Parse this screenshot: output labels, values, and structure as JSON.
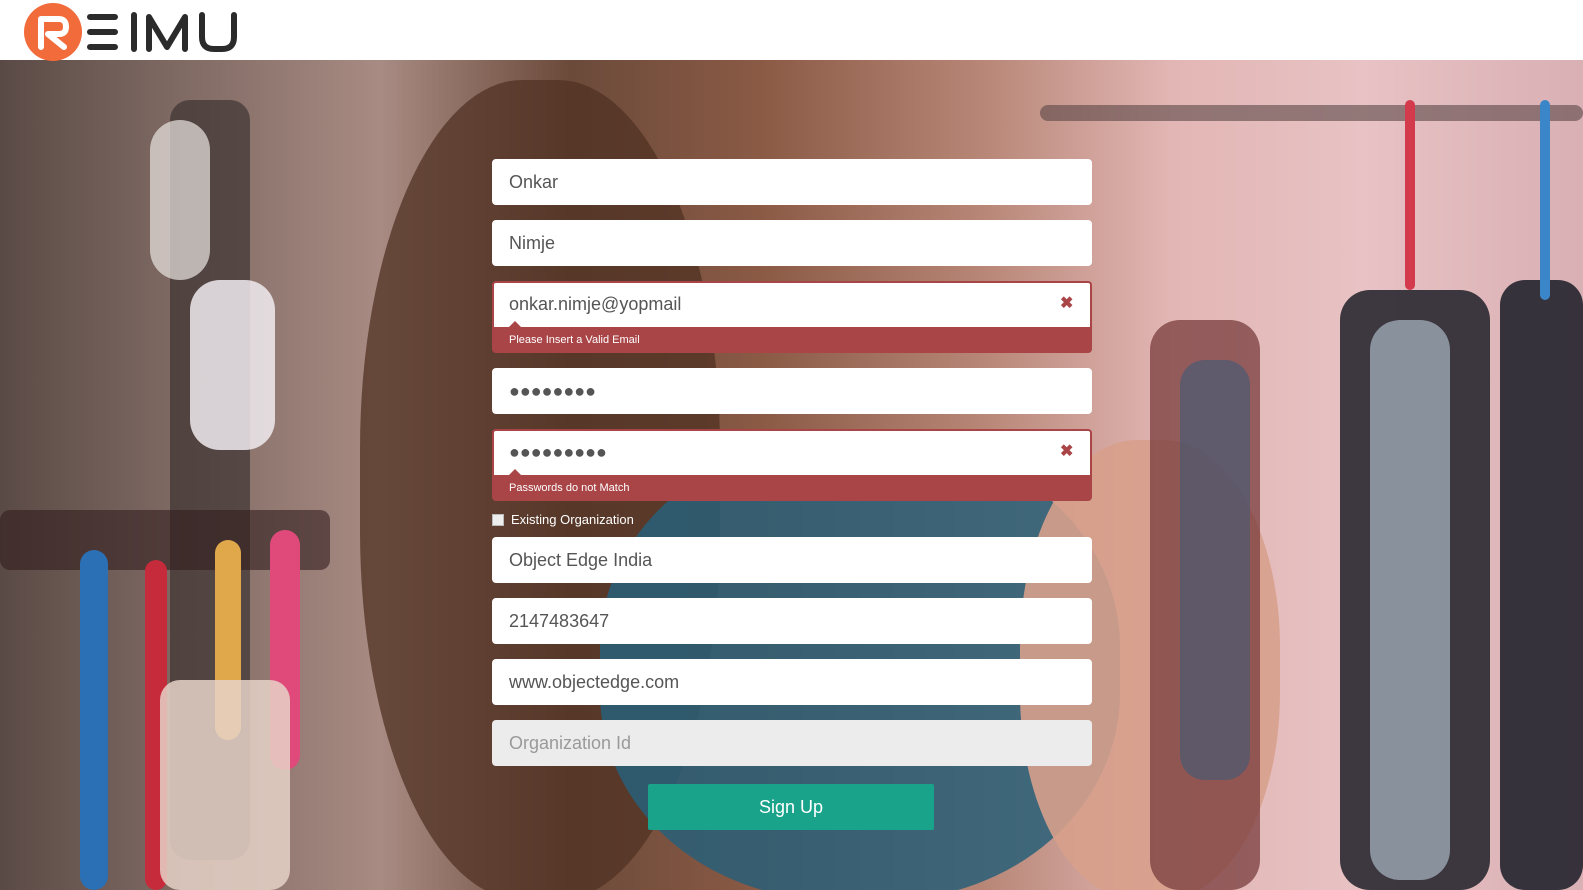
{
  "brand": {
    "logo_text": "REIMU",
    "accent": "#f26b3a"
  },
  "form": {
    "first_name": "Onkar",
    "last_name": "Nimje",
    "email": "onkar.nimje@yopmail",
    "email_error": "Please Insert a Valid Email",
    "password": "●●●●●●●●",
    "confirm_password": "●●●●●●●●●",
    "password_error": "Passwords do not Match",
    "existing_org_label": "Existing Organization",
    "organization": "Object Edge India",
    "phone": "2147483647",
    "website": "www.objectedge.com",
    "org_id_placeholder": "Organization Id",
    "submit_label": "Sign Up"
  },
  "colors": {
    "error": "#a94447",
    "button": "#1aa38b"
  },
  "icons": {
    "error": "close-icon",
    "logo": "reimu-logo"
  }
}
